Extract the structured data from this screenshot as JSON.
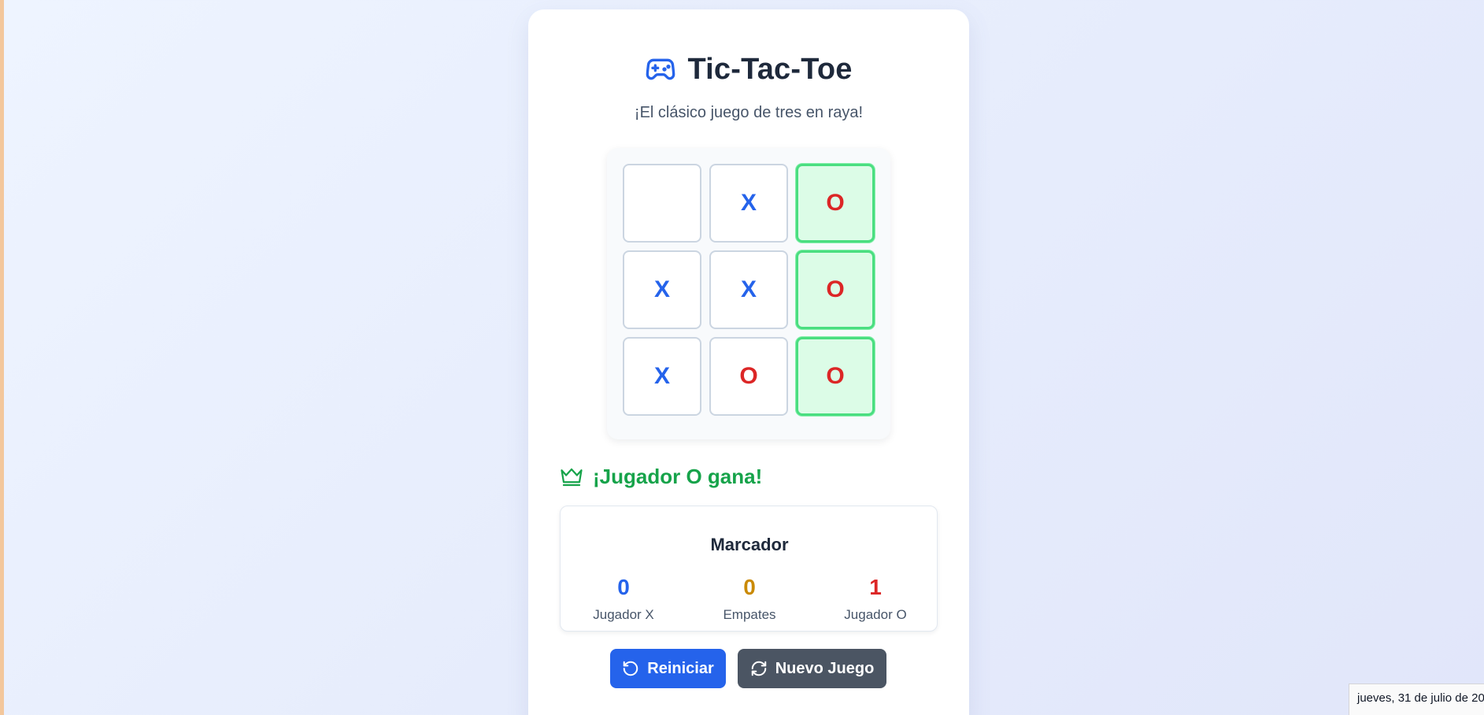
{
  "header": {
    "title": "Tic-Tac-Toe",
    "subtitle": "¡El clásico juego de tres en raya!",
    "icon": "gamepad-icon"
  },
  "accent_colors": {
    "primary": "#2563eb",
    "x_mark": "#2563eb",
    "o_mark": "#dc2626",
    "win": "#16a34a",
    "draw": "#ca8a04"
  },
  "board": {
    "cells": [
      {
        "value": "",
        "win": false
      },
      {
        "value": "X",
        "win": false
      },
      {
        "value": "O",
        "win": true
      },
      {
        "value": "X",
        "win": false
      },
      {
        "value": "X",
        "win": false
      },
      {
        "value": "O",
        "win": true
      },
      {
        "value": "X",
        "win": false
      },
      {
        "value": "O",
        "win": false
      },
      {
        "value": "O",
        "win": true
      }
    ]
  },
  "status": {
    "text": "¡Jugador O gana!",
    "icon": "crown-icon"
  },
  "scoreboard": {
    "title": "Marcador",
    "x_score": "0",
    "x_label": "Jugador X",
    "draws": "0",
    "draws_label": "Empates",
    "o_score": "1",
    "o_label": "Jugador O"
  },
  "buttons": {
    "reset_label": "Reiniciar",
    "reset_icon": "rotate-ccw-icon",
    "new_game_label": "Nuevo Juego",
    "new_game_icon": "refresh-icon"
  },
  "taskbar": {
    "date": "jueves, 31 de julio de 20"
  }
}
